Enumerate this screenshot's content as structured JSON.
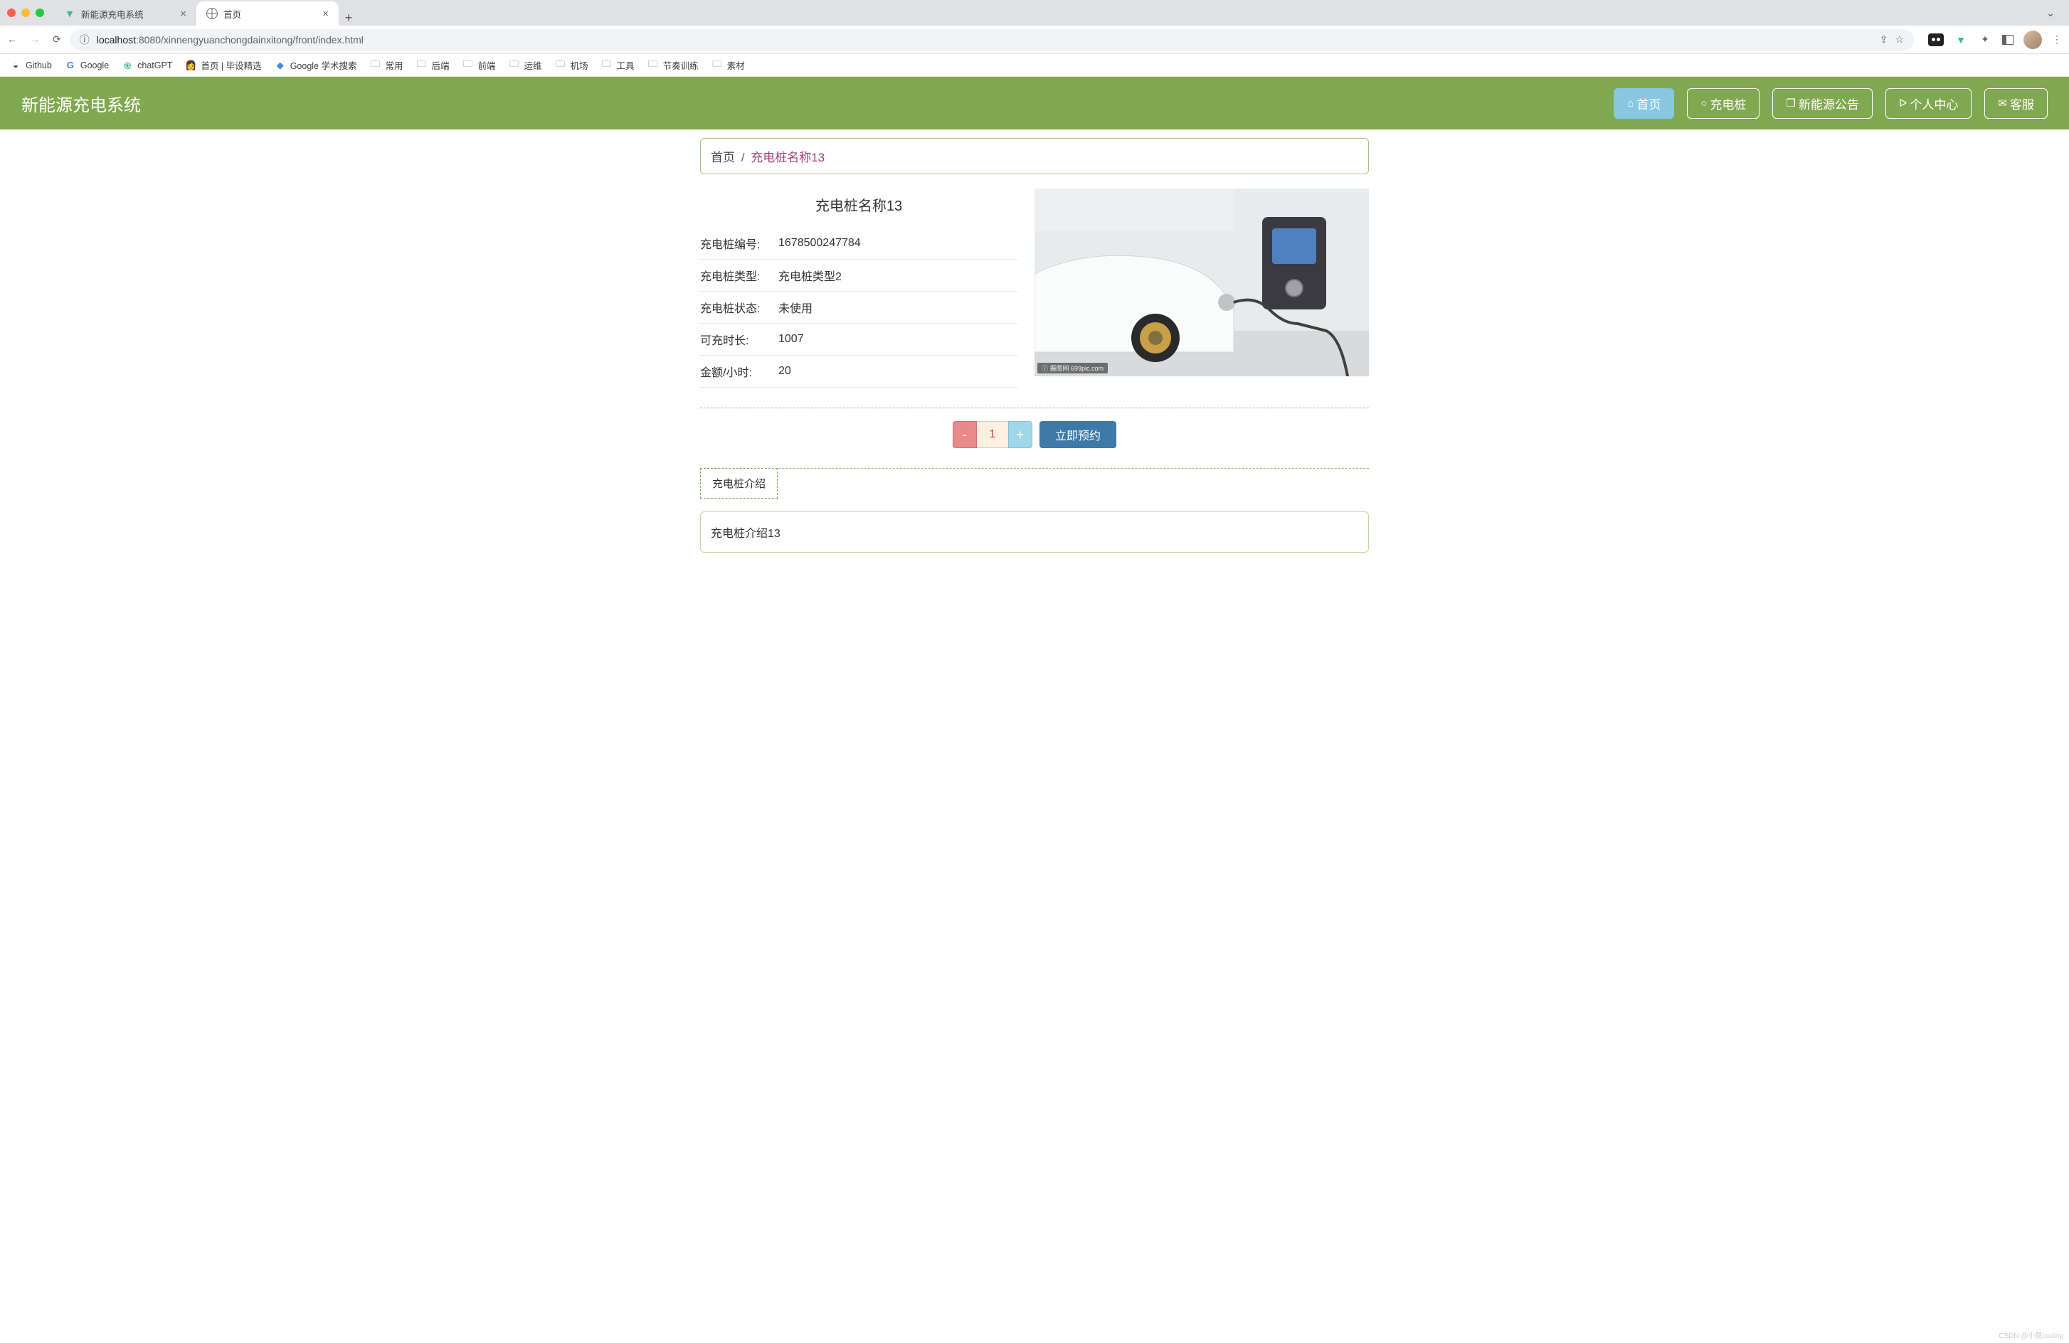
{
  "browser": {
    "tabs": [
      {
        "title": "新能源充电系统",
        "active": false
      },
      {
        "title": "首页",
        "active": true
      }
    ],
    "url_host": "localhost",
    "url_port": ":8080",
    "url_path": "/xinnengyuanchongdainxitong/front/index.html"
  },
  "bookmarks": [
    {
      "label": "Github",
      "type": "link"
    },
    {
      "label": "Google",
      "type": "g"
    },
    {
      "label": "chatGPT",
      "type": "gpt"
    },
    {
      "label": "首页 | 毕设精选",
      "type": "person"
    },
    {
      "label": "Google 学术搜索",
      "type": "scholar"
    },
    {
      "label": "常用",
      "type": "folder"
    },
    {
      "label": "后端",
      "type": "folder"
    },
    {
      "label": "前端",
      "type": "folder"
    },
    {
      "label": "运维",
      "type": "folder"
    },
    {
      "label": "机场",
      "type": "folder"
    },
    {
      "label": "工具",
      "type": "folder"
    },
    {
      "label": "节奏训练",
      "type": "folder"
    },
    {
      "label": "素材",
      "type": "folder"
    }
  ],
  "app": {
    "title": "新能源充电系统",
    "nav": {
      "home": "首页",
      "charger": "充电桩",
      "notice": "新能源公告",
      "profile": "个人中心",
      "service": "客服"
    }
  },
  "breadcrumb": {
    "home": "首页",
    "sep": "/",
    "current": "充电桩名称13"
  },
  "detail": {
    "title": "充电桩名称13",
    "rows": {
      "id_label": "充电桩编号:",
      "id_value": "1678500247784",
      "type_label": "充电桩类型:",
      "type_value": "充电桩类型2",
      "status_label": "充电桩状态:",
      "status_value": "未使用",
      "duration_label": "可充时长:",
      "duration_value": "1007",
      "price_label": "金额/小时:",
      "price_value": "20"
    },
    "image_watermark": "ⓘ 摄图网 699pic.com"
  },
  "action": {
    "minus": "-",
    "qty": "1",
    "plus": "+",
    "book": "立即预约"
  },
  "intro": {
    "tab": "充电桩介绍",
    "content": "充电桩介绍13"
  },
  "page_watermark": "CSDN @小莫coding"
}
